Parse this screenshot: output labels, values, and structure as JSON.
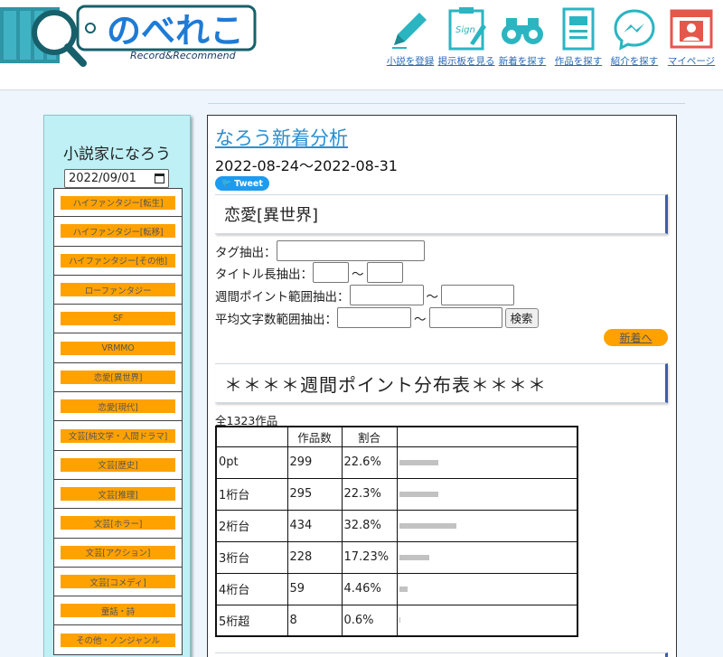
{
  "header": {
    "logo_text": "のべれこ",
    "logo_sub": "Record&Recommend",
    "nav": [
      {
        "label": "小説を登録",
        "icon": "pen-icon"
      },
      {
        "label": "掲示板を見る",
        "icon": "sign-board-icon"
      },
      {
        "label": "新着を探す",
        "icon": "binoculars-icon"
      },
      {
        "label": "作品を探す",
        "icon": "document-icon"
      },
      {
        "label": "紹介を探す",
        "icon": "messenger-icon"
      },
      {
        "label": "マイページ",
        "icon": "user-profile-icon"
      }
    ]
  },
  "sidebar": {
    "title": "小説家になろう",
    "date_value": "2022/09/01",
    "genres": [
      "ハイファンタジー[転生]",
      "ハイファンタジー[転移]",
      "ハイファンタジー[その他]",
      "ローファンタジー",
      "SF",
      "VRMMO",
      "恋愛[異世界]",
      "恋愛[現代]",
      "文芸[純文学・人間ドラマ]",
      "文芸[歴史]",
      "文芸[推理]",
      "文芸[ホラー]",
      "文芸[アクション]",
      "文芸[コメディ]",
      "童話・詩",
      "その他・ノンジャンル"
    ]
  },
  "main": {
    "title": "なろう新着分析",
    "period": "2022-08-24〜2022-08-31",
    "tweet_label": "Tweet",
    "genre_heading": "恋愛[異世界]",
    "filters": {
      "tag_label": "タグ抽出：",
      "title_len_label": "タイトル長抽出：",
      "weekly_pt_label": "週間ポイント範囲抽出：",
      "avg_chars_label": "平均文字数範囲抽出：",
      "tilde": "〜",
      "search_label": "検索"
    },
    "next_label": "新着へ",
    "dist_heading": "＊＊＊＊週間ポイント分布表＊＊＊＊",
    "total": "全1323作品",
    "table": {
      "headers": [
        "",
        "作品数",
        "割合",
        ""
      ],
      "rows": [
        {
          "range": "0pt",
          "count": "299",
          "ratio": "22.6%",
          "fraction": 0.226
        },
        {
          "range": "1桁台",
          "count": "295",
          "ratio": "22.3%",
          "fraction": 0.223
        },
        {
          "range": "2桁台",
          "count": "434",
          "ratio": "32.8%",
          "fraction": 0.328
        },
        {
          "range": "3桁台",
          "count": "228",
          "ratio": "17.23%",
          "fraction": 0.1723
        },
        {
          "range": "4桁台",
          "count": "59",
          "ratio": "4.46%",
          "fraction": 0.0446
        },
        {
          "range": "5桁超",
          "count": "8",
          "ratio": "0.6%",
          "fraction": 0.006
        }
      ]
    }
  },
  "colors": {
    "accent_orange": "#ffa200",
    "sidebar_bg": "#bff0f5",
    "link_blue": "#2a8fd0",
    "icon_teal": "#2bb5c1",
    "icon_red": "#e4574b"
  }
}
